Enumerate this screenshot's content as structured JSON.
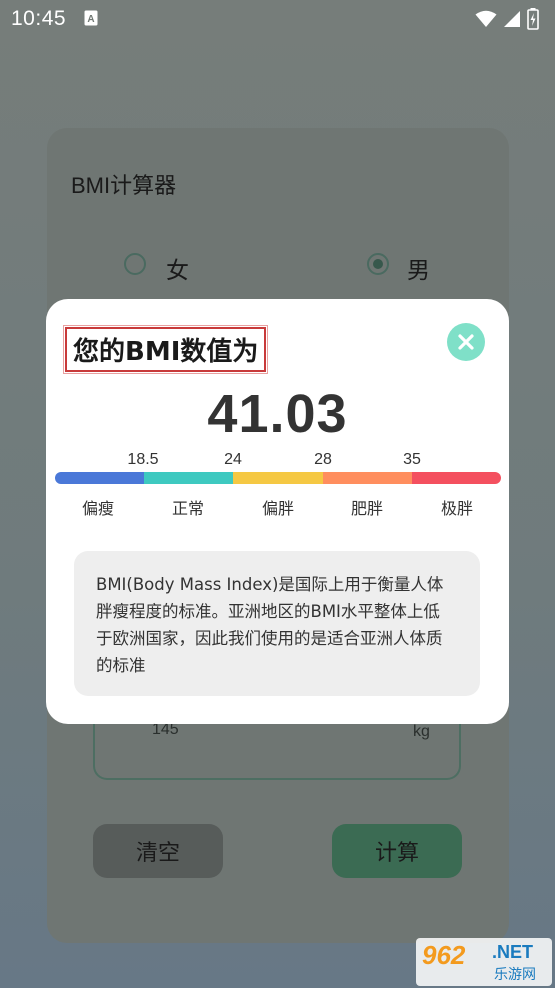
{
  "status_bar": {
    "time": "10:45",
    "icons": [
      "a-notification-icon",
      "wifi-icon",
      "signal-icon",
      "battery-charging-icon"
    ]
  },
  "background": {
    "title": "BMI计算器",
    "gender_female": "女",
    "gender_male": "男",
    "selected_gender": "男",
    "weight_value": "145",
    "weight_unit": "kg",
    "clear_label": "清空",
    "calc_label": "计算"
  },
  "dialog": {
    "title": "您的BMI数值为",
    "bmi_value": "41.03",
    "ticks": [
      "18.5",
      "24",
      "28",
      "35"
    ],
    "categories": [
      "偏瘦",
      "正常",
      "偏胖",
      "肥胖",
      "极胖"
    ],
    "colors": [
      "#4a78d8",
      "#3ec9c0",
      "#f5c843",
      "#ff8e5e",
      "#f4505f"
    ],
    "description": "BMI(Body Mass Index)是国际上用于衡量人体 胖瘦程度的标准。亚洲地区的BMI水平整体上低 于欧洲国家，因此我们使用的是适合亚洲人体质 的标准",
    "close_icon": "close-icon",
    "accent": "#7fe0c8"
  },
  "watermark": {
    "number": "962",
    "domain": ".NET",
    "subtitle": "乐游网"
  }
}
